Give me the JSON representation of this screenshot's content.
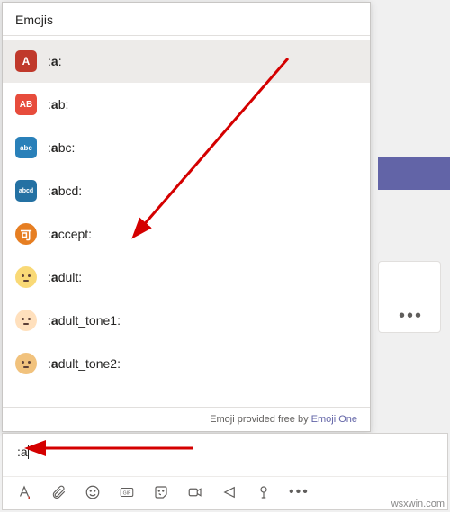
{
  "panel": {
    "title": "Emojis",
    "items": [
      {
        "icon": "ic-a",
        "text": "A",
        "prefix": ":",
        "match": "a",
        "rest": ":",
        "selected": true
      },
      {
        "icon": "ic-ab",
        "text": "AB",
        "prefix": ":",
        "match": "a",
        "rest": "b:"
      },
      {
        "icon": "ic-abc",
        "text": "abc",
        "prefix": ":",
        "match": "a",
        "rest": "bc:"
      },
      {
        "icon": "ic-abcd",
        "text": "abcd",
        "prefix": ":",
        "match": "a",
        "rest": "bcd:"
      },
      {
        "icon": "ic-accept",
        "text": "可",
        "prefix": ":",
        "match": "a",
        "rest": "ccept:"
      },
      {
        "icon": "ic-adult",
        "face": true,
        "prefix": ":",
        "match": "a",
        "rest": "dult:"
      },
      {
        "icon": "ic-adult1",
        "face": true,
        "prefix": ":",
        "match": "a",
        "rest": "dult_tone1:"
      },
      {
        "icon": "ic-adult2",
        "face": true,
        "prefix": ":",
        "match": "a",
        "rest": "dult_tone2:"
      }
    ],
    "footer_text": "Emoji provided free by ",
    "footer_link": "Emoji One"
  },
  "compose": {
    "value": ":a"
  },
  "toolbar": {
    "format": "format-icon",
    "attach": "attach-icon",
    "emoji": "emoji-icon",
    "gif": "gif-icon",
    "sticker": "sticker-icon",
    "meet": "meet-icon",
    "stream": "stream-icon",
    "praise": "praise-icon",
    "more": "•••"
  },
  "watermark": "wsxwin.com"
}
